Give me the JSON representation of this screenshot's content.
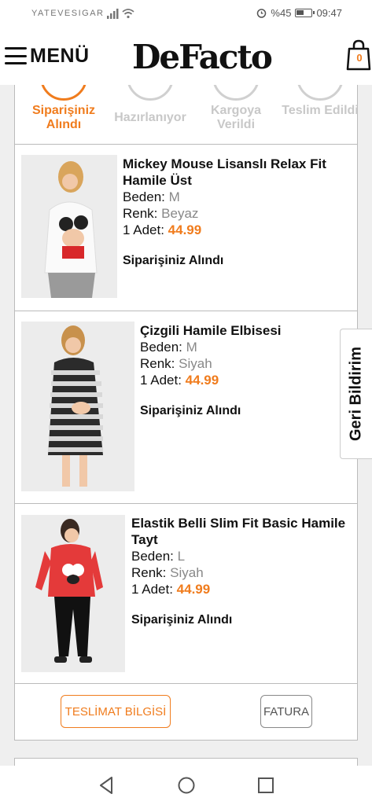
{
  "status_bar": {
    "carrier": "YATEVESIGAR",
    "battery": "%45",
    "time": "09:47"
  },
  "header": {
    "menu_label": "MENÜ",
    "logo": "DeFacto",
    "cart_count": "0"
  },
  "steps": [
    {
      "label": "Siparişiniz Alındı",
      "active": true
    },
    {
      "label": "Hazırlanıyor",
      "active": false
    },
    {
      "label": "Kargoya Verildi",
      "active": false
    },
    {
      "label": "Teslim Edildi",
      "active": false
    }
  ],
  "items": [
    {
      "name": "Mickey Mouse Lisanslı Relax Fit Hamile Üst",
      "beden_label": "Beden:",
      "beden": "M",
      "renk_label": "Renk:",
      "renk": "Beyaz",
      "qty_label": "1 Adet:",
      "price": "44.99",
      "status": "Siparişiniz Alındı"
    },
    {
      "name": "Çizgili Hamile Elbisesi",
      "beden_label": "Beden:",
      "beden": "M",
      "renk_label": "Renk:",
      "renk": "Siyah",
      "qty_label": "1 Adet:",
      "price": "44.99",
      "status": "Siparişiniz Alındı"
    },
    {
      "name": "Elastik Belli Slim Fit Basic Hamile Tayt",
      "beden_label": "Beden:",
      "beden": "L",
      "renk_label": "Renk:",
      "renk": "Siyah",
      "qty_label": "1 Adet:",
      "price": "44.99",
      "status": "Siparişiniz Alındı"
    }
  ],
  "actions": {
    "teslimat": "TESLİMAT BİLGİSİ",
    "fatura": "FATURA"
  },
  "feedback": "Geri Bildirim",
  "colors": {
    "accent": "#f07c1d",
    "muted": "#c8c8c8",
    "border": "#bbbbbb"
  }
}
